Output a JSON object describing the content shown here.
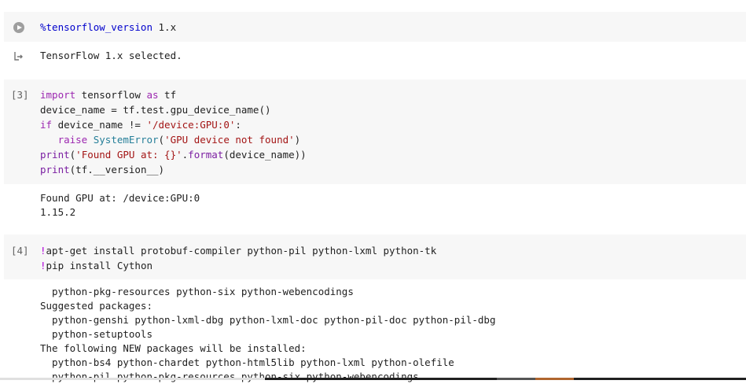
{
  "cells": [
    {
      "execution_count": "",
      "code": [
        [
          {
            "t": "%tensorflow_version",
            "c": "magic"
          },
          {
            "t": " 1.x",
            "c": ""
          }
        ]
      ],
      "output": [
        "TensorFlow 1.x selected."
      ]
    },
    {
      "execution_count": "[3]",
      "code": [
        [
          {
            "t": "import",
            "c": "kw"
          },
          {
            "t": " tensorflow ",
            "c": ""
          },
          {
            "t": "as",
            "c": "kw"
          },
          {
            "t": " tf",
            "c": ""
          }
        ],
        [
          {
            "t": "device_name = tf.test.gpu_device_name()",
            "c": ""
          }
        ],
        [
          {
            "t": "if",
            "c": "kw"
          },
          {
            "t": " device_name != ",
            "c": ""
          },
          {
            "t": "'/device:GPU:0'",
            "c": "str"
          },
          {
            "t": ":",
            "c": ""
          }
        ],
        [
          {
            "t": "   ",
            "c": ""
          },
          {
            "t": "raise",
            "c": "kw"
          },
          {
            "t": " ",
            "c": ""
          },
          {
            "t": "SystemError",
            "c": "cls"
          },
          {
            "t": "(",
            "c": ""
          },
          {
            "t": "'GPU device not found'",
            "c": "str"
          },
          {
            "t": ")",
            "c": ""
          }
        ],
        [
          {
            "t": "print",
            "c": "kw2"
          },
          {
            "t": "(",
            "c": ""
          },
          {
            "t": "'Found GPU at: {}'",
            "c": "str"
          },
          {
            "t": ".",
            "c": ""
          },
          {
            "t": "format",
            "c": "kw2"
          },
          {
            "t": "(device_name))",
            "c": ""
          }
        ],
        [
          {
            "t": "print",
            "c": "kw2"
          },
          {
            "t": "(tf.__version__)",
            "c": ""
          }
        ]
      ],
      "output": [
        "Found GPU at: /device:GPU:0",
        "1.15.2"
      ]
    },
    {
      "execution_count": "[4]",
      "code": [
        [
          {
            "t": "!",
            "c": "shell"
          },
          {
            "t": "apt-get install protobuf-compiler python-pil python-lxml python-tk",
            "c": ""
          }
        ],
        [
          {
            "t": "!",
            "c": "shell"
          },
          {
            "t": "pip install Cython",
            "c": ""
          }
        ]
      ],
      "output": [
        "  python-pkg-resources python-six python-webencodings",
        "Suggested packages:",
        "  python-genshi python-lxml-dbg python-lxml-doc python-pil-doc python-pil-dbg",
        "  python-setuptools",
        "The following NEW packages will be installed:",
        "  python-bs4 python-chardet python-html5lib python-lxml python-olefile",
        "  python-pil python-pkg-resources python-six python-webencodings"
      ]
    }
  ],
  "icons": {
    "run": "play-circle-icon",
    "output": "output-arrow-icon"
  },
  "colors": {
    "cell_background": "#f7f7f7",
    "keyword": "#9c27b0",
    "string": "#a31515",
    "class": "#267f99",
    "magic": "#0000cc",
    "shell": "#af00db"
  }
}
